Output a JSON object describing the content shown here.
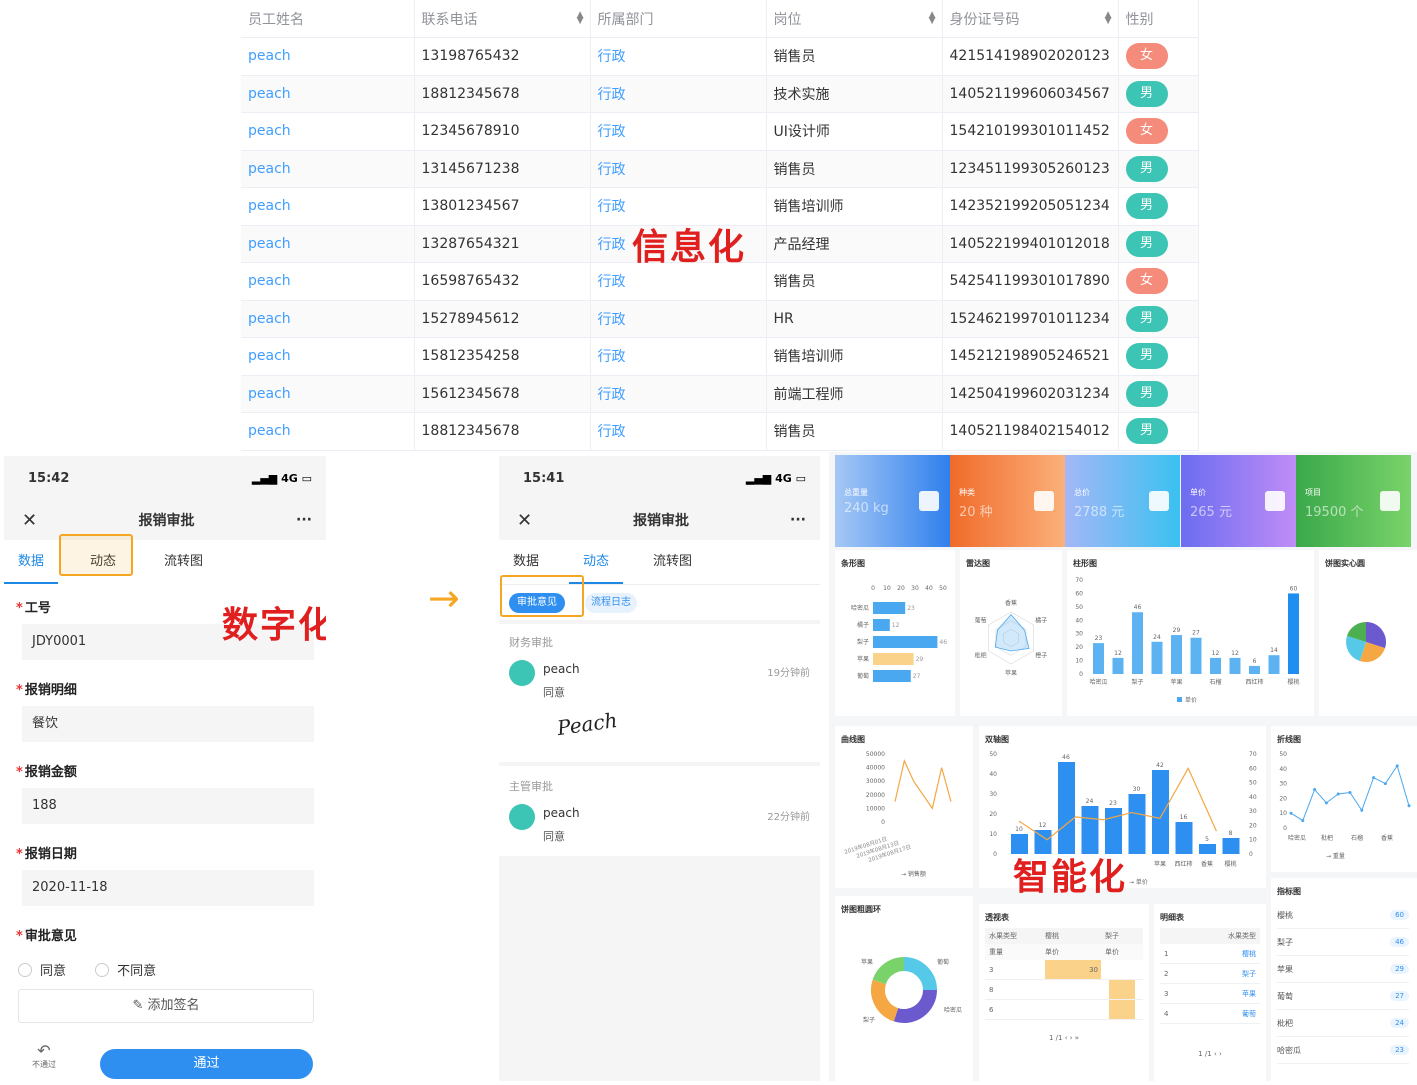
{
  "table": {
    "headers": [
      "员工姓名",
      "联系电话",
      "所属部门",
      "岗位",
      "身份证号码",
      "性别"
    ],
    "rows": [
      [
        "peach",
        "13198765432",
        "行政",
        "销售员",
        "421514198902020123",
        "女"
      ],
      [
        "peach",
        "18812345678",
        "行政",
        "技术实施",
        "140521199606034567",
        "男"
      ],
      [
        "peach",
        "12345678910",
        "行政",
        "UI设计师",
        "154210199301011452",
        "女"
      ],
      [
        "peach",
        "13145671238",
        "行政",
        "销售员",
        "123451199305260123",
        "男"
      ],
      [
        "peach",
        "13801234567",
        "行政",
        "销售培训师",
        "142352199205051234",
        "男"
      ],
      [
        "peach",
        "13287654321",
        "行政",
        "产品经理",
        "140522199401012018",
        "男"
      ],
      [
        "peach",
        "16598765432",
        "行政",
        "销售员",
        "542541199301017890",
        "女"
      ],
      [
        "peach",
        "15278945612",
        "行政",
        "HR",
        "152462199701011234",
        "男"
      ],
      [
        "peach",
        "15812354258",
        "行政",
        "销售培训师",
        "145212198905246521",
        "男"
      ],
      [
        "peach",
        "15612345678",
        "行政",
        "前端工程师",
        "142504199602031234",
        "男"
      ],
      [
        "peach",
        "18812345678",
        "行政",
        "销售员",
        "140521198402154012",
        "男"
      ]
    ]
  },
  "labels": {
    "info": "信息化",
    "digital": "数字化",
    "smart": "智能化"
  },
  "phone1": {
    "time": "15:42",
    "signal": "4G",
    "title": "报销审批",
    "more": "···",
    "tabs": [
      "数据",
      "动态",
      "流转图"
    ],
    "fields": [
      {
        "label": "工号",
        "value": "JDY0001"
      },
      {
        "label": "报销明细",
        "value": "餐饮"
      },
      {
        "label": "报销金额",
        "value": "188"
      },
      {
        "label": "报销日期",
        "value": "2020-11-18"
      }
    ],
    "opinion_label": "审批意见",
    "agree": "同意",
    "disagree": "不同意",
    "sign": "添加签名",
    "reject": "不通过",
    "pass": "通过"
  },
  "phone2": {
    "time": "15:41",
    "signal": "4G",
    "title": "报销审批",
    "more": "···",
    "tabs": [
      "数据",
      "动态",
      "流转图"
    ],
    "chips": [
      "审批意见",
      "流程日志"
    ],
    "sections": [
      {
        "heading": "财务审批",
        "user": "peach",
        "status": "同意",
        "time": "19分钟前",
        "signature": "Peach"
      },
      {
        "heading": "主管审批",
        "user": "peach",
        "status": "同意",
        "time": "22分钟前"
      }
    ]
  },
  "dashboard": {
    "kpis": [
      {
        "label": "总重量",
        "value": "240 kg",
        "color1": "#2f80ed",
        "color2": "#a6c8f5"
      },
      {
        "label": "种类",
        "value": "20 种",
        "color1": "#fbb07a",
        "color2": "#f06b2a"
      },
      {
        "label": "总价",
        "value": "2788 元",
        "color1": "#3ac1f0",
        "color2": "#a3b7f7"
      },
      {
        "label": "单价",
        "value": "265 元",
        "color1": "#c08cf7",
        "color2": "#6b6df0"
      },
      {
        "label": "项目",
        "value": "19500 个",
        "color1": "#7ad36a",
        "color2": "#3aa84a"
      }
    ],
    "card_titles": [
      "条形图",
      "雷达图",
      "柱形图",
      "饼图实心圆",
      "曲线图",
      "双轴图",
      "折线图",
      "指标图",
      "饼图粗圆环",
      "透视表",
      "明细表"
    ],
    "indicator": {
      "items": [
        "樱桃",
        "梨子",
        "苹果",
        "葡萄",
        "枇杷",
        "哈密瓜"
      ],
      "values": [
        "60",
        "46",
        "29",
        "27",
        "24",
        "23"
      ]
    },
    "pivot": {
      "headers": [
        "水果类型",
        "樱桃",
        "梨子"
      ],
      "sub": [
        "重量",
        "单价",
        "单价"
      ],
      "rows": [
        "3",
        "8",
        "6"
      ],
      "cell": "30"
    },
    "detail": {
      "header": "水果类型",
      "rows": [
        [
          "1",
          "樱桃"
        ],
        [
          "2",
          "梨子"
        ],
        [
          "3",
          "苹果"
        ],
        [
          "4",
          "葡萄"
        ]
      ]
    },
    "pager": "1 /1",
    "legend": {
      "unit": "单价",
      "weight": "重量",
      "sales": "销售额"
    }
  },
  "chart_data": [
    {
      "type": "bar",
      "title": "条形图",
      "orientation": "horizontal",
      "categories": [
        "哈密瓜",
        "橘子",
        "梨子",
        "苹果",
        "葡萄"
      ],
      "values": [
        23,
        12,
        46,
        29,
        27
      ],
      "xlim": [
        0,
        50
      ],
      "xticks": [
        0,
        10,
        20,
        30,
        40,
        50
      ]
    },
    {
      "type": "radar",
      "title": "雷达图",
      "categories": [
        "香蕉",
        "橘子",
        "橙子",
        "苹果",
        "枇杷",
        "葡萄"
      ]
    },
    {
      "type": "bar",
      "title": "柱形图",
      "categories": [
        "哈密瓜",
        "",
        "梨子",
        "",
        "苹果",
        "",
        "石榴",
        "",
        "西红柿",
        "",
        "樱桃"
      ],
      "values": [
        23,
        12,
        46,
        24,
        29,
        27,
        12,
        12,
        6,
        14,
        60
      ],
      "ylim": [
        0,
        70
      ],
      "yticks": [
        0,
        10,
        20,
        30,
        40,
        50,
        60,
        70
      ],
      "series": [
        {
          "name": "单价"
        }
      ]
    },
    {
      "type": "pie",
      "title": "饼图实心圆",
      "values": [
        30,
        25,
        25,
        20
      ],
      "colors": [
        "#6a5acd",
        "#f4a742",
        "#56c9e8",
        "#4caf50"
      ]
    },
    {
      "type": "line",
      "title": "曲线图",
      "x": [
        "2019年08月01日",
        "2019年08月13日",
        "2019年08月17日"
      ],
      "values": [
        15000,
        45000,
        30000,
        20000,
        10000,
        40000,
        15000
      ],
      "ylim": [
        0,
        50000
      ],
      "yticks": [
        0,
        10000,
        20000,
        30000,
        40000,
        50000
      ],
      "series": [
        {
          "name": "销售额"
        }
      ]
    },
    {
      "type": "bar",
      "title": "双轴图",
      "categories": [
        "",
        "",
        "",
        "",
        "",
        "",
        "苹果",
        "西红柿",
        "香蕉",
        "樱桃"
      ],
      "values": [
        10,
        12,
        46,
        24,
        23,
        30,
        42,
        16,
        5,
        8
      ],
      "line_values": [
        23,
        10,
        26,
        24,
        29,
        25,
        60,
        16
      ],
      "ylim": [
        0,
        50
      ],
      "yticks": [
        0,
        10,
        20,
        30,
        40,
        50
      ],
      "y2lim": [
        0,
        70
      ],
      "y2ticks": [
        0,
        10,
        20,
        30,
        40,
        50,
        60,
        70
      ],
      "series": [
        {
          "name": "单价"
        }
      ]
    },
    {
      "type": "line",
      "title": "折线图",
      "categories": [
        "哈密瓜",
        "枇杷",
        "石榴",
        "香蕉"
      ],
      "values": [
        10,
        5,
        26,
        17,
        23,
        24,
        12,
        34,
        30,
        42,
        15
      ],
      "ylim": [
        0,
        50
      ],
      "yticks": [
        0,
        10,
        20,
        30,
        40,
        50
      ],
      "series": [
        {
          "name": "重量"
        }
      ]
    },
    {
      "type": "pie",
      "title": "饼图粗圆环",
      "categories": [
        "苹果",
        "葡萄",
        "哈密瓜",
        "梨子"
      ],
      "values": [
        25,
        30,
        25,
        20
      ]
    }
  ]
}
